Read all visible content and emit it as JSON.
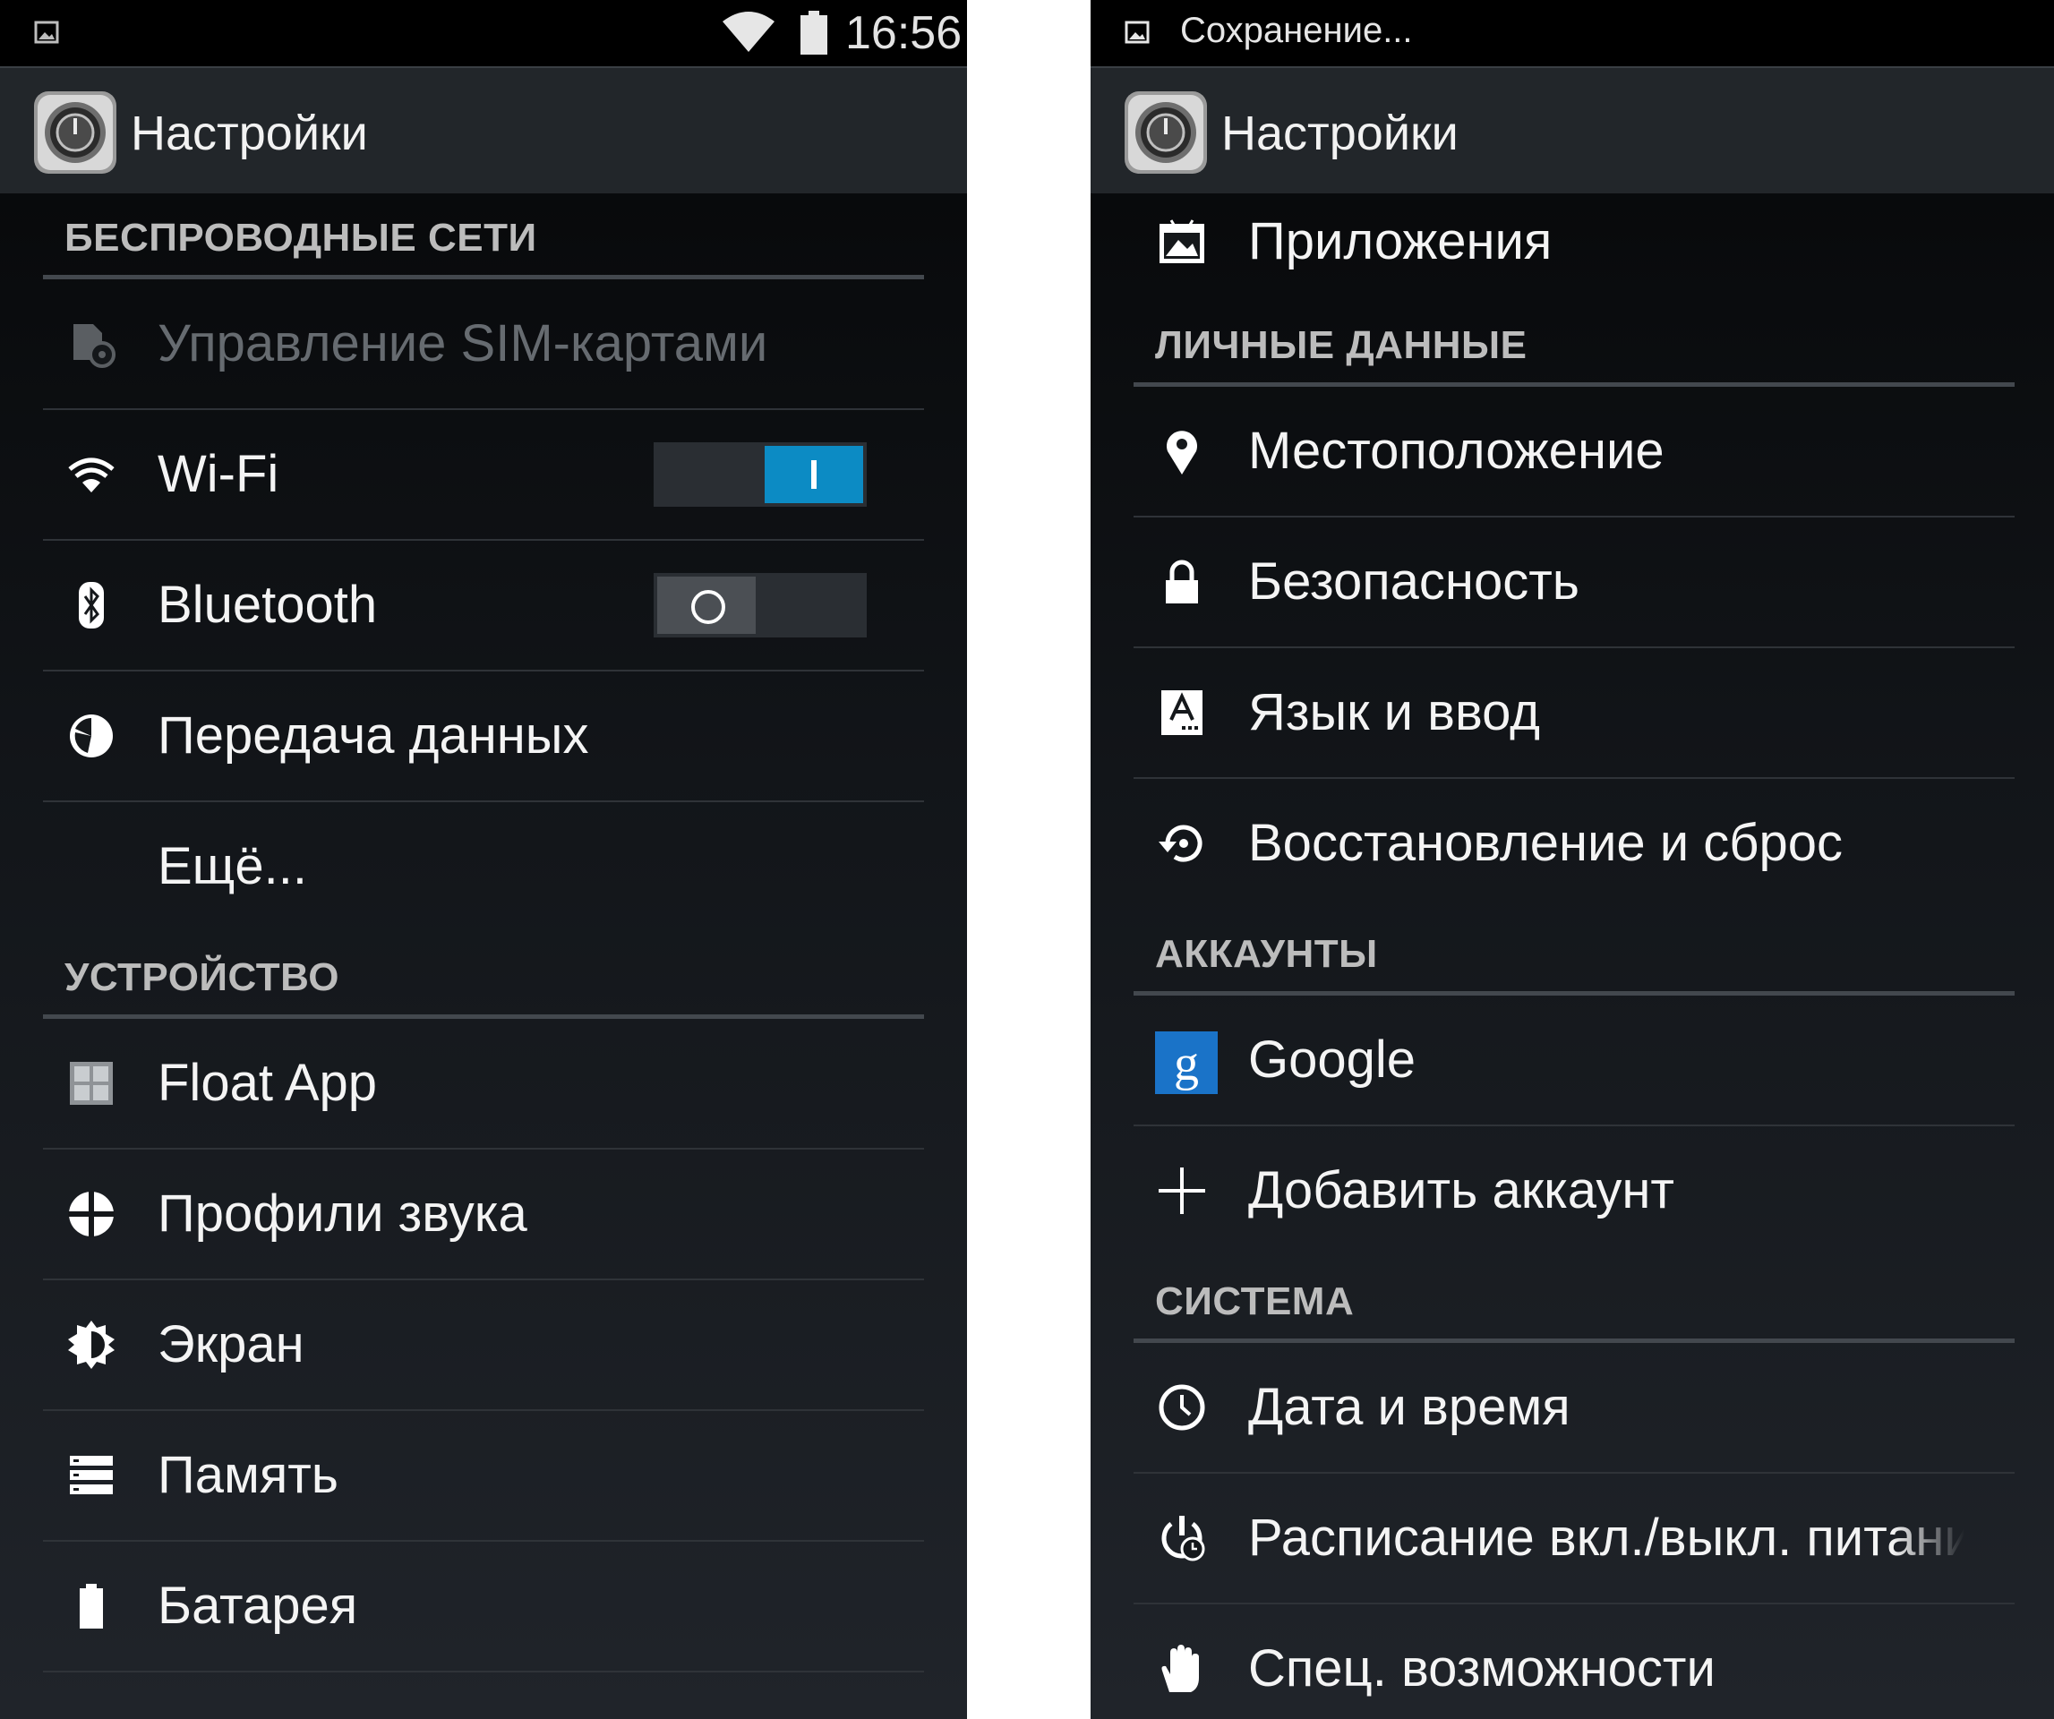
{
  "left": {
    "status_bar": {
      "time": "16:56"
    },
    "app_title": "Настройки",
    "sections": [
      {
        "header": "БЕСПРОВОДНЫЕ СЕТИ",
        "items": [
          {
            "label": "Управление SIM-картами",
            "icon": "sim-management-icon",
            "enabled": false
          },
          {
            "label": "Wi-Fi",
            "icon": "wifi-icon",
            "toggle": "on"
          },
          {
            "label": "Bluetooth",
            "icon": "bluetooth-icon",
            "toggle": "off"
          },
          {
            "label": "Передача данных",
            "icon": "data-usage-icon"
          },
          {
            "label": "Ещё...",
            "icon": ""
          }
        ]
      },
      {
        "header": "УСТРОЙСТВО",
        "items": [
          {
            "label": "Float App",
            "icon": "float-app-icon"
          },
          {
            "label": "Профили звука",
            "icon": "sound-profiles-icon"
          },
          {
            "label": "Экран",
            "icon": "display-icon"
          },
          {
            "label": "Память",
            "icon": "storage-icon"
          },
          {
            "label": "Батарея",
            "icon": "battery-icon"
          }
        ]
      }
    ]
  },
  "right": {
    "status_bar": {
      "notification": "Сохранение..."
    },
    "app_title": "Настройки",
    "top_item": {
      "label": "Приложения",
      "icon": "apps-icon"
    },
    "sections": [
      {
        "header": "ЛИЧНЫЕ ДАННЫЕ",
        "items": [
          {
            "label": "Местоположение",
            "icon": "location-pin-icon"
          },
          {
            "label": "Безопасность",
            "icon": "lock-icon"
          },
          {
            "label": "Язык и ввод",
            "icon": "language-input-icon"
          },
          {
            "label": "Восстановление и сброс",
            "icon": "backup-restore-icon"
          }
        ]
      },
      {
        "header": "АККАУНТЫ",
        "items": [
          {
            "label": "Google",
            "icon": "google-icon"
          },
          {
            "label": "Добавить аккаунт",
            "icon": "plus-icon"
          }
        ]
      },
      {
        "header": "СИСТЕМА",
        "items": [
          {
            "label": "Дата и время",
            "icon": "clock-icon"
          },
          {
            "label": "Расписание вкл./выкл. питания",
            "icon": "power-schedule-icon"
          },
          {
            "label": "Спец. возможности",
            "icon": "accessibility-hand-icon"
          }
        ]
      }
    ]
  },
  "colors": {
    "accent": "#0c8bc4",
    "header_text": "#bcbcbc",
    "divider": "#43484e"
  }
}
